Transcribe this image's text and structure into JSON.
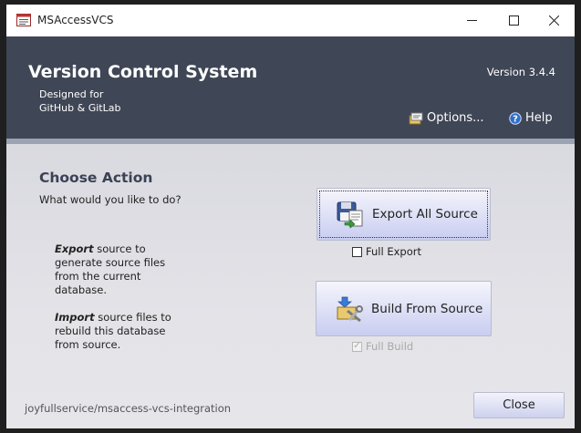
{
  "window": {
    "title": "MSAccessVCS",
    "controls": [
      "minimize-icon",
      "maximize-icon",
      "close-icon"
    ]
  },
  "header": {
    "title": "Version Control System",
    "version": "Version 3.4.4",
    "designed_line1": "Designed for",
    "designed_line2": "GitHub & GitLab",
    "options_label": "Options...",
    "help_label": "Help"
  },
  "body": {
    "choose_title": "Choose Action",
    "choose_sub": "What would you like to do?",
    "export_desc_bold": "Export",
    "export_desc_rest": " source to generate source files from the current database.",
    "import_desc_bold": "Import",
    "import_desc_rest": " source files to rebuild this database from source.",
    "export_button": "Export All Source",
    "full_export_label": "Full Export",
    "full_export_checked": false,
    "build_button": "Build From Source",
    "full_build_label": "Full Build",
    "full_build_checked": true,
    "repo_link": "joyfullservice/msaccess-vcs-integration",
    "close_button": "Close"
  },
  "colors": {
    "header_bg": "#3f4655",
    "title_accent": "#3a4254",
    "button_gradient_end": "#c9cdf0"
  }
}
